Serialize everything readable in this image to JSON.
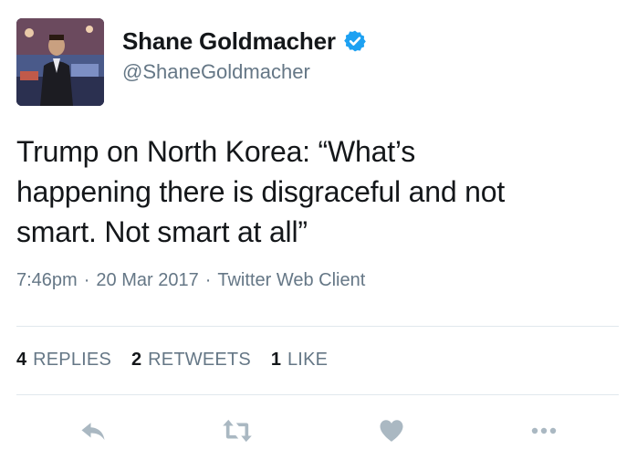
{
  "author": {
    "display_name": "Shane Goldmacher",
    "handle": "@ShaneGoldmacher",
    "verified": true,
    "avatar_icon": "user-photo"
  },
  "tweet": {
    "text": "Trump on North Korea: “What’s\nhappening there is disgraceful and not\nsmart. Not smart at all”"
  },
  "meta": {
    "time": "7:46pm",
    "date": "20 Mar 2017",
    "source": "Twitter Web Client",
    "separator": "·"
  },
  "stats": {
    "replies_count": "4",
    "replies_label": "REPLIES",
    "retweets_count": "2",
    "retweets_label": "RETWEETS",
    "likes_count": "1",
    "likes_label": "LIKE"
  },
  "actions": {
    "reply_icon": "reply-icon",
    "retweet_icon": "retweet-icon",
    "like_icon": "heart-icon",
    "more_icon": "more-icon"
  },
  "colors": {
    "text": "#14171a",
    "secondary": "#657786",
    "verified": "#1da1f2",
    "icon": "#aab8c2",
    "divider": "#e1e8ed"
  }
}
